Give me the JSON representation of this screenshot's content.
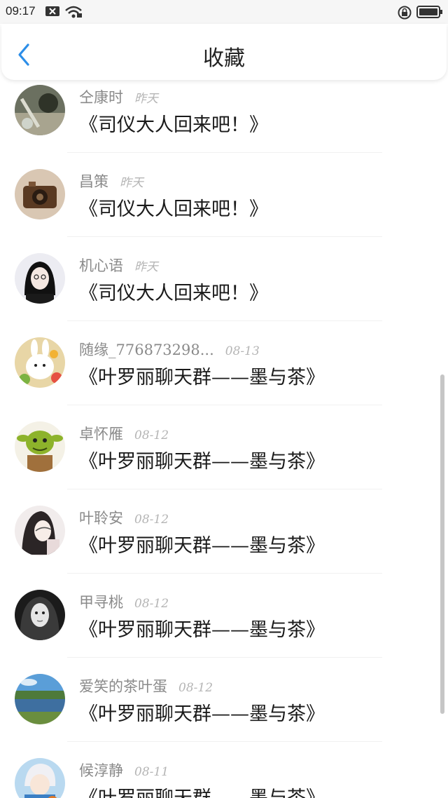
{
  "status_bar": {
    "time": "09:17"
  },
  "header": {
    "title": "收藏"
  },
  "colors": {
    "accent": "#2c8ee8",
    "name_gray": "#8a8a8a",
    "time_gray": "#b5b5b5"
  },
  "items": [
    {
      "user": "仝康时",
      "time": "昨天",
      "title": "《司仪大人回来吧！》",
      "avatar": "avatar-landscape-dark"
    },
    {
      "user": "昌策",
      "time": "昨天",
      "title": "《司仪大人回来吧！》",
      "avatar": "avatar-camera"
    },
    {
      "user": "机心语",
      "time": "昨天",
      "title": "《司仪大人回来吧！》",
      "avatar": "avatar-cartoon-girl"
    },
    {
      "user": "随缘_776873298...",
      "time": "08-13",
      "title": "《叶罗丽聊天群——墨与茶》",
      "avatar": "avatar-bunny-food"
    },
    {
      "user": "卓怀雁",
      "time": "08-12",
      "title": "《叶罗丽聊天群——墨与茶》",
      "avatar": "avatar-green-ogre"
    },
    {
      "user": "叶聆安",
      "time": "08-12",
      "title": "《叶罗丽聊天群——墨与茶》",
      "avatar": "avatar-girl-sketch"
    },
    {
      "user": "甲寻桃",
      "time": "08-12",
      "title": "《叶罗丽聊天群——墨与茶》",
      "avatar": "avatar-bw-portrait"
    },
    {
      "user": "爱笑的茶叶蛋",
      "time": "08-12",
      "title": "《叶罗丽聊天群——墨与茶》",
      "avatar": "avatar-lake-landscape"
    },
    {
      "user": "候淳静",
      "time": "08-11",
      "title": "《叶罗丽聊天群——墨与茶》",
      "avatar": "avatar-anime-boy"
    }
  ]
}
